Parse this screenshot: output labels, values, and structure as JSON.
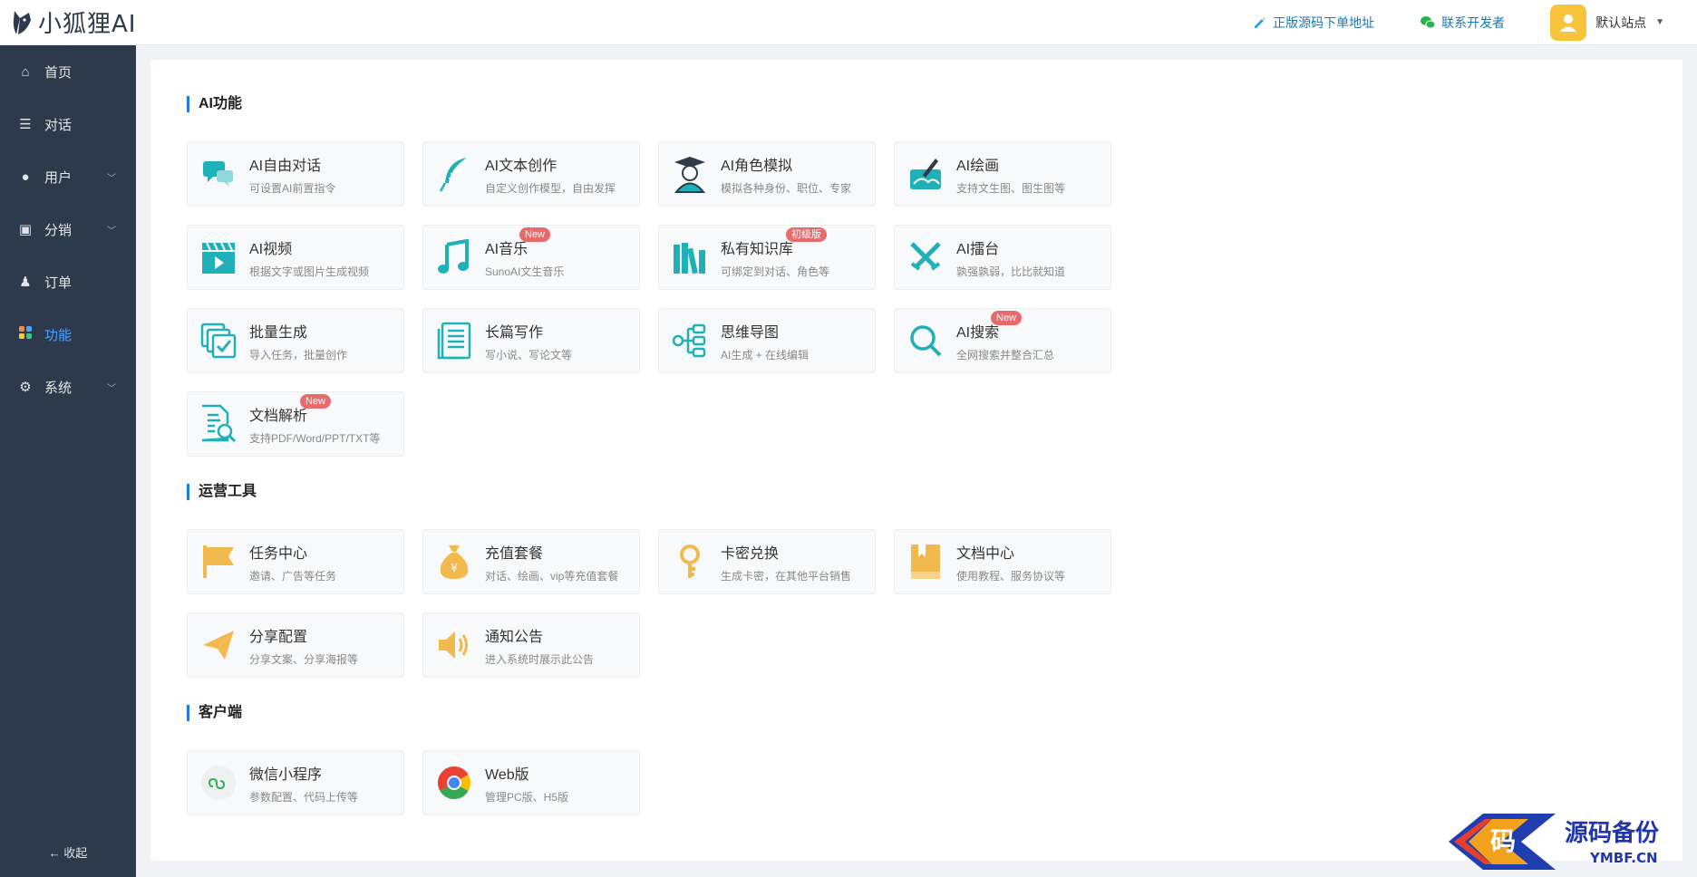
{
  "app": {
    "logo_text": "小狐狸AI"
  },
  "header": {
    "link_source": "正版源码下单地址",
    "link_contact": "联系开发者",
    "user_name": "默认站点"
  },
  "sidebar": {
    "items": [
      {
        "label": "首页"
      },
      {
        "label": "对话"
      },
      {
        "label": "用户"
      },
      {
        "label": "分销"
      },
      {
        "label": "订单"
      },
      {
        "label": "功能"
      },
      {
        "label": "系统"
      }
    ],
    "collapse_label": "收起"
  },
  "sections": {
    "ai": {
      "title": "AI功能",
      "cards": [
        {
          "title": "AI自由对话",
          "desc": "可设置AI前置指令"
        },
        {
          "title": "AI文本创作",
          "desc": "自定义创作模型，自由发挥"
        },
        {
          "title": "AI角色模拟",
          "desc": "模拟各种身份、职位、专家"
        },
        {
          "title": "AI绘画",
          "desc": "支持文生图、图生图等"
        },
        {
          "title": "AI视频",
          "desc": "根据文字或图片生成视频"
        },
        {
          "title": "AI音乐",
          "desc": "SunoAI文生音乐",
          "badge": "New"
        },
        {
          "title": "私有知识库",
          "desc": "可绑定到对话、角色等",
          "badge": "初级版"
        },
        {
          "title": "AI擂台",
          "desc": "孰强孰弱，比比就知道"
        },
        {
          "title": "批量生成",
          "desc": "导入任务，批量创作"
        },
        {
          "title": "长篇写作",
          "desc": "写小说、写论文等"
        },
        {
          "title": "思维导图",
          "desc": "AI生成 + 在线编辑"
        },
        {
          "title": "AI搜索",
          "desc": "全网搜索并整合汇总",
          "badge": "New"
        },
        {
          "title": "文档解析",
          "desc": "支持PDF/Word/PPT/TXT等",
          "badge": "New"
        }
      ]
    },
    "ops": {
      "title": "运营工具",
      "cards": [
        {
          "title": "任务中心",
          "desc": "邀请、广告等任务"
        },
        {
          "title": "充值套餐",
          "desc": "对话、绘画、vip等充值套餐"
        },
        {
          "title": "卡密兑换",
          "desc": "生成卡密，在其他平台销售"
        },
        {
          "title": "文档中心",
          "desc": "使用教程、服务协议等"
        },
        {
          "title": "分享配置",
          "desc": "分享文案、分享海报等"
        },
        {
          "title": "通知公告",
          "desc": "进入系统时展示此公告"
        }
      ]
    },
    "client": {
      "title": "客户端",
      "cards": [
        {
          "title": "微信小程序",
          "desc": "参数配置、代码上传等"
        },
        {
          "title": "Web版",
          "desc": "管理PC版、H5版"
        }
      ]
    }
  },
  "watermark": {
    "char": "码",
    "main": "源码备份",
    "sub": "YMBF.CN"
  },
  "colors": {
    "sidebar_bg": "#2d3a4b",
    "accent": "#1f7ee6",
    "teal": "#1fb0b8",
    "orange": "#f2b94e",
    "badge": "#e86a6a"
  }
}
